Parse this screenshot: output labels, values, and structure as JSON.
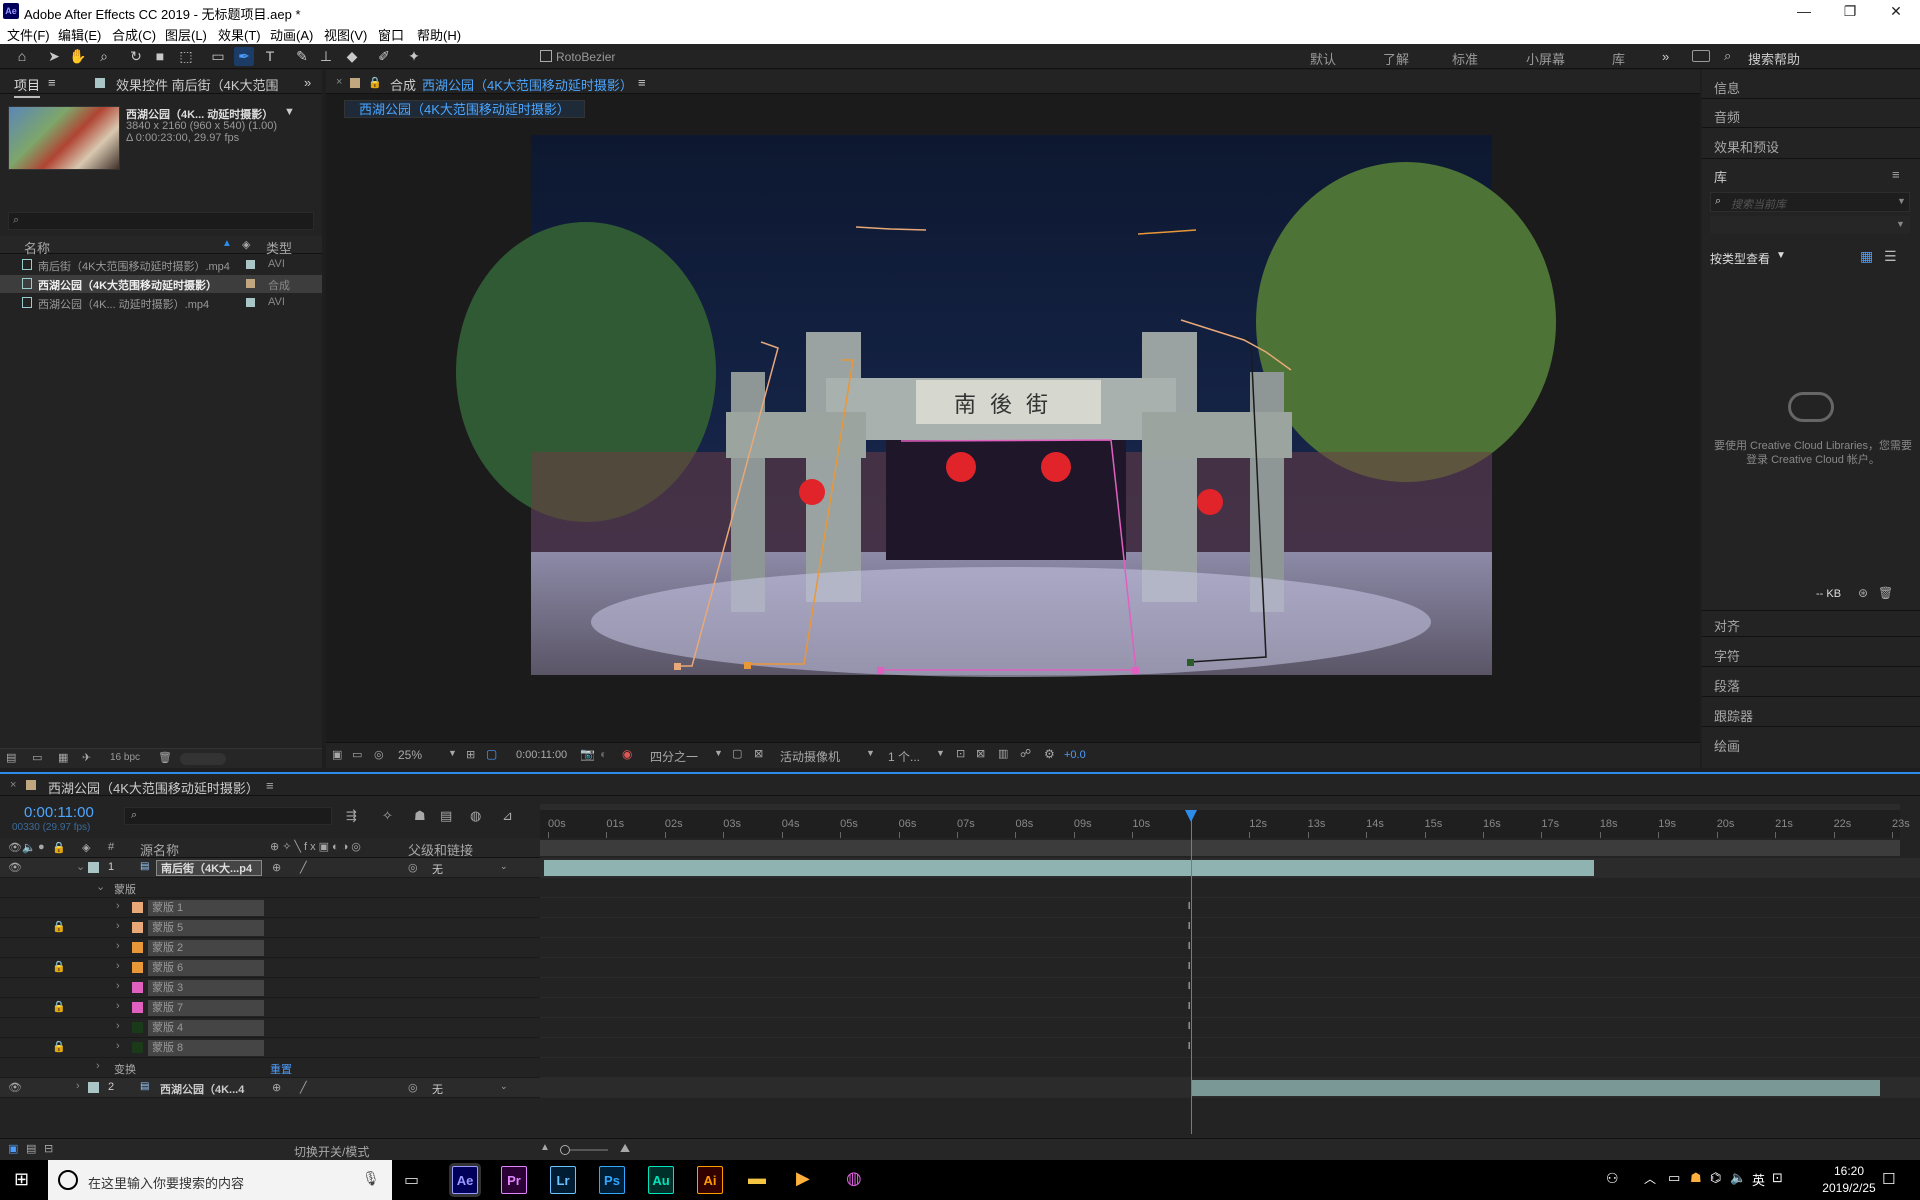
{
  "window": {
    "title": "Adobe After Effects CC 2019 - 无标题项目.aep *",
    "app_badge": "Ae",
    "minimize": "—",
    "restore": "❐",
    "close": "✕"
  },
  "menu": [
    "文件(F)",
    "编辑(E)",
    "合成(C)",
    "图层(L)",
    "效果(T)",
    "动画(A)",
    "视图(V)",
    "窗口",
    "帮助(H)"
  ],
  "toolbar": {
    "rotobezier": "RotoBezier",
    "workspaces": [
      "默认",
      "了解",
      "标准",
      "小屏幕",
      "库"
    ],
    "more": "»",
    "search_help": "搜索帮助"
  },
  "project_panel": {
    "tab_project": "项目",
    "tab_effects": "效果控件 南后街（4K大范围",
    "thumb_name": "西湖公园（4K... 动延时摄影）",
    "thumb_info1": "3840 x 2160  (960 x 540) (1.00)",
    "thumb_info2": "Δ 0:00:23:00, 29.97 fps",
    "search_placeholder": "",
    "col_name": "名称",
    "col_type": "类型",
    "items": [
      {
        "name": "南后街（4K大范围移动延时摄影）.mp4",
        "type": "AVI",
        "color": "#a9c5c5"
      },
      {
        "name": "西湖公园（4K大范围移动延时摄影）",
        "type": "合成",
        "color": "#c0a780"
      },
      {
        "name": "西湖公园（4K... 动延时摄影）.mp4",
        "type": "AVI",
        "color": "#a9c5c5"
      }
    ],
    "bpc": "16 bpc"
  },
  "comp_panel": {
    "tab_prefix": "合成",
    "tab_name": "西湖公园（4K大范围移动延时摄影）",
    "breadcrumb": "西湖公园（4K大范围移动延时摄影）",
    "zoom": "25%",
    "timecode": "0:00:11:00",
    "resolution": "四分之一",
    "camera": "活动摄像机",
    "views": "1 个...",
    "exposure": "+0.0",
    "sign_text": "南後街"
  },
  "right_panel": {
    "info": "信息",
    "audio": "音频",
    "effects": "效果和预设",
    "library": "库",
    "lib_search": "搜索当前库",
    "view_by": "按类型查看",
    "cc_msg": "要使用 Creative Cloud Libraries，您需要登录 Creative Cloud 帐户。",
    "kb": "-- KB",
    "align": "对齐",
    "char": "字符",
    "para": "段落",
    "tracker": "跟踪器",
    "paint": "绘画"
  },
  "timeline": {
    "tab_name": "西湖公园（4K大范围移动延时摄影）",
    "timecode": "0:00:11:00",
    "frames": "00330 (29.97 fps)",
    "col_source": "源名称",
    "col_parent": "父级和链接",
    "ruler": [
      "00s",
      "01s",
      "02s",
      "03s",
      "04s",
      "05s",
      "06s",
      "07s",
      "08s",
      "09s",
      "10s",
      "",
      "12s",
      "13s",
      "14s",
      "15s",
      "16s",
      "17s",
      "18s",
      "19s",
      "20s",
      "21s",
      "22s",
      "23s"
    ],
    "layer1": {
      "num": "1",
      "name": "南后街（4K大...p4",
      "parent": "无"
    },
    "masks_group": "蒙版",
    "masks": [
      {
        "name": "蒙版 1",
        "color": "#e8a878",
        "locked": false
      },
      {
        "name": "蒙版 5",
        "color": "#e8a878",
        "locked": true
      },
      {
        "name": "蒙版 2",
        "color": "#e89838",
        "locked": false
      },
      {
        "name": "蒙版 6",
        "color": "#e89838",
        "locked": true
      },
      {
        "name": "蒙版 3",
        "color": "#e060c0",
        "locked": false
      },
      {
        "name": "蒙版 7",
        "color": "#e060c0",
        "locked": true
      },
      {
        "name": "蒙版 4",
        "color": "#1a3a1a",
        "locked": false
      },
      {
        "name": "蒙版 8",
        "color": "#1a3a1a",
        "locked": true
      }
    ],
    "transform": "变换",
    "reset": "重置",
    "layer2": {
      "num": "2",
      "name": "西湖公园（4K...4",
      "parent": "无"
    },
    "footer_toggle": "切换开关/模式",
    "playhead_seconds": 11,
    "duration_seconds": 23
  },
  "taskbar": {
    "search": "在这里输入你要搜索的内容",
    "apps": [
      {
        "label": "Ae",
        "bg": "#00005b",
        "fg": "#9999ff"
      },
      {
        "label": "Pr",
        "bg": "#2a0035",
        "fg": "#e084ff"
      },
      {
        "label": "Lr",
        "bg": "#001d34",
        "fg": "#6cc2ff"
      },
      {
        "label": "Ps",
        "bg": "#001e36",
        "fg": "#31a8ff"
      },
      {
        "label": "Au",
        "bg": "#00302a",
        "fg": "#00e4bb"
      },
      {
        "label": "Ai",
        "bg": "#330000",
        "fg": "#ff9a00"
      }
    ],
    "lang": "英",
    "time": "16:20",
    "date": "2019/2/25"
  }
}
